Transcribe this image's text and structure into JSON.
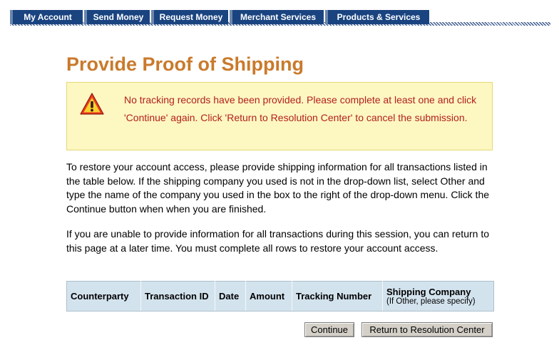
{
  "nav": {
    "tabs": [
      {
        "label": "My Account"
      },
      {
        "label": "Send Money"
      },
      {
        "label": "Request Money"
      },
      {
        "label": "Merchant Services"
      },
      {
        "label": "Products & Services"
      }
    ]
  },
  "page": {
    "title": "Provide Proof of Shipping"
  },
  "alert": {
    "icon": "warning-triangle-icon",
    "message": "No tracking records have been provided. Please complete at least one and click 'Continue' again. Click 'Return to Resolution Center' to cancel the submission."
  },
  "instructions": {
    "paragraph1": "To restore your account access, please provide shipping information for all transactions listed in the table below. If the shipping company you used is not in the drop-down list, select Other and type the name of the company you used in the box to the right of the drop-down menu. Click the Continue button when when you are finished.",
    "paragraph2": "If you are unable to provide information for all transactions during this session, you can return to this page at a later time. You must complete all rows to restore your account access."
  },
  "table": {
    "columns": [
      {
        "label": "Counterparty"
      },
      {
        "label": "Transaction ID"
      },
      {
        "label": "Date"
      },
      {
        "label": "Amount"
      },
      {
        "label": "Tracking Number"
      },
      {
        "label": "Shipping Company",
        "sublabel": "(If Other, please specify)"
      }
    ]
  },
  "buttons": {
    "continue": "Continue",
    "return": "Return to Resolution Center"
  },
  "colors": {
    "nav_tab": "#1a4480",
    "title": "#c97a2c",
    "alert_bg": "#fdf7c2",
    "alert_text": "#b3211b",
    "table_header": "#d3e3ee"
  }
}
